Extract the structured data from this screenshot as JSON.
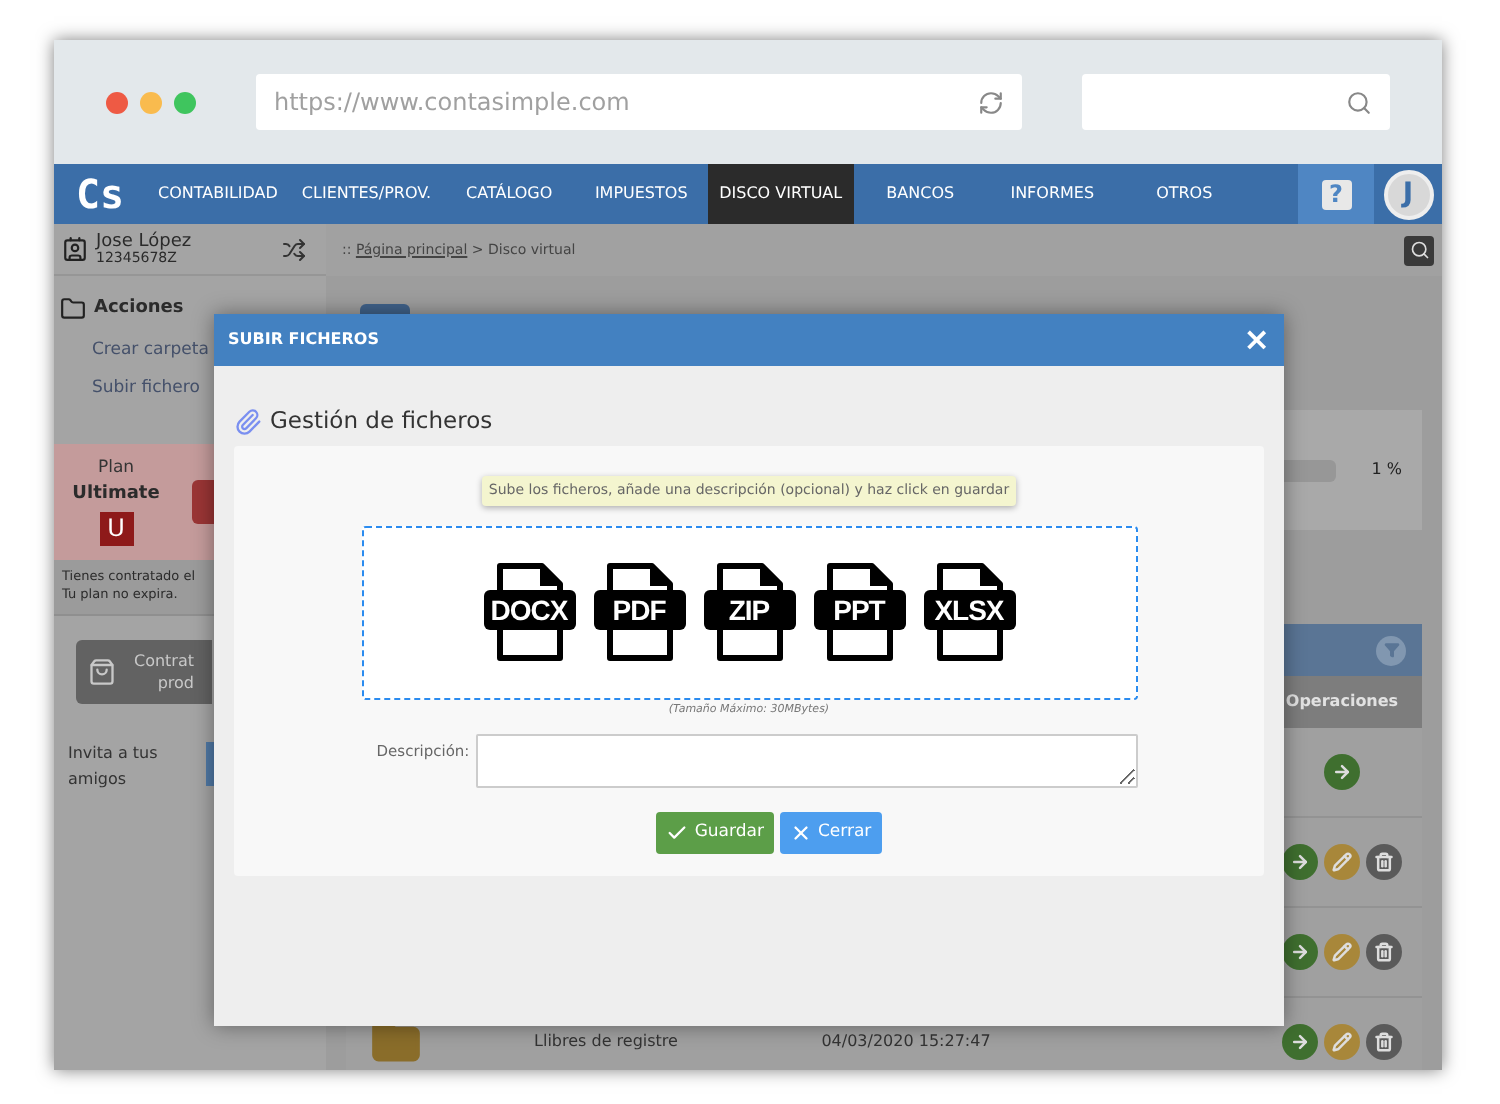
{
  "browser": {
    "url": "https://www.contasimple.com"
  },
  "nav": {
    "logo": "Cs",
    "items": [
      {
        "label": "CONTABILIDAD",
        "selected": false
      },
      {
        "label": "CLIENTES/PROV.",
        "selected": false
      },
      {
        "label": "CATÁLOGO",
        "selected": false
      },
      {
        "label": "IMPUESTOS",
        "selected": false
      },
      {
        "label": "DISCO VIRTUAL",
        "selected": true
      },
      {
        "label": "BANCOS",
        "selected": false
      },
      {
        "label": "INFORMES",
        "selected": false
      },
      {
        "label": "OTROS",
        "selected": false
      }
    ],
    "help": "?",
    "avatar": "J"
  },
  "sidebar": {
    "user_name": "Jose López",
    "user_id": "12345678Z",
    "actions_title": "Acciones",
    "actions": [
      "Crear carpeta",
      "Subir fichero"
    ],
    "plan_label": "Plan",
    "plan_name": "Ultimate",
    "plan_badge": "U",
    "plan_note": [
      "Tienes contratado el",
      "Tu plan no expira."
    ],
    "buy_button": [
      "Contrat",
      "prod"
    ],
    "invite": "Invita a tus amigos"
  },
  "breadcrumb": {
    "prefix": "::",
    "link": "Página principal",
    "current": "> Disco virtual"
  },
  "stats": {
    "percent": "1 %"
  },
  "table": {
    "operations_header": "Operaciones",
    "rows": [
      {
        "actions": [
          {
            "kind": "open"
          }
        ]
      },
      {
        "actions": [
          {
            "kind": "open"
          },
          {
            "kind": "edit"
          },
          {
            "kind": "delete"
          }
        ]
      },
      {
        "actions": [
          {
            "kind": "open"
          },
          {
            "kind": "edit"
          },
          {
            "kind": "delete"
          }
        ]
      },
      {
        "name": "Llibres de registre",
        "date": "04/03/2020 15:27:47",
        "actions": [
          {
            "kind": "open"
          },
          {
            "kind": "edit"
          },
          {
            "kind": "delete"
          }
        ]
      }
    ]
  },
  "modal": {
    "title": "SUBIR FICHEROS",
    "close": "×",
    "heading": "Gestión de ficheros",
    "hint": "Sube los ficheros, añade una descripción (opcional) y haz click en guardar",
    "file_types": [
      "DOCX",
      "PDF",
      "ZIP",
      "PPT",
      "XLSX"
    ],
    "max_size": "(Tamaño Máximo: 30MBytes)",
    "description_label": "Descripción:",
    "buttons": [
      {
        "kind": "save",
        "label": "Guardar"
      },
      {
        "kind": "cancel",
        "label": "Cerrar"
      }
    ]
  }
}
